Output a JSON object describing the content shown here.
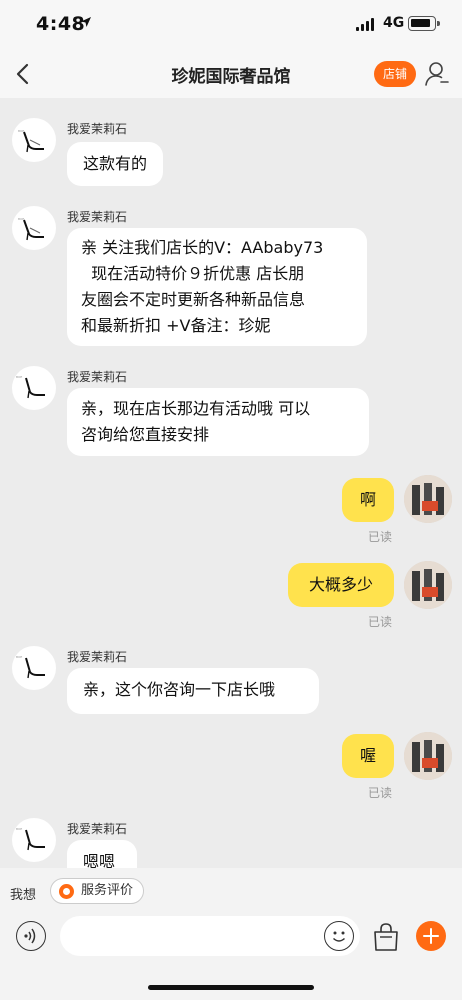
{
  "status_bar": {
    "time": "4:48",
    "network": "4G"
  },
  "header": {
    "title": "珍妮国际奢品馆",
    "store_button": "店铺"
  },
  "messages": [
    {
      "side": "left",
      "sender": "我爱茉莉石",
      "lines": [
        "这款有的"
      ]
    },
    {
      "side": "left",
      "sender": "我爱茉莉石",
      "lines": [
        "亲 关注我们店长的V：AAbaby73",
        "  现在活动特价９折优惠 店长朋",
        "友圈会不定时更新各种新品信息",
        "和最新折扣 +V备注：珍妮"
      ]
    },
    {
      "side": "left",
      "sender": "我爱茉莉石",
      "lines": [
        "亲，现在店长那边有活动哦 可以",
        "咨询给您直接安排"
      ]
    },
    {
      "side": "right",
      "text": "啊",
      "status": "已读"
    },
    {
      "side": "right",
      "text": "大概多少",
      "status": "已读"
    },
    {
      "side": "left",
      "sender": "我爱茉莉石",
      "lines": [
        "亲，这个你咨询一下店长哦"
      ]
    },
    {
      "side": "right",
      "text": "喔",
      "status": "已读"
    },
    {
      "side": "left",
      "sender": "我爱茉莉石",
      "lines": [
        "嗯嗯"
      ]
    }
  ],
  "quick_bar": {
    "label": "我想",
    "service_button": "服务评价"
  },
  "input": {
    "placeholder": ""
  },
  "colors": {
    "accent": "#ff6a13",
    "bubble_self": "#ffe24d",
    "bubble_other": "#ffffff",
    "background": "#ececec"
  }
}
